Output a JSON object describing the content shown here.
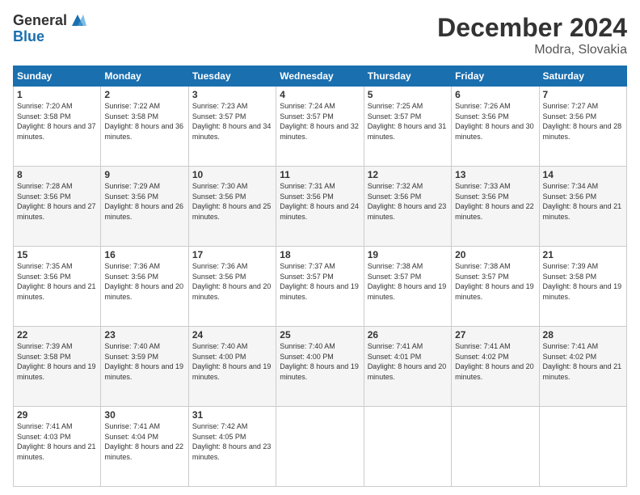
{
  "logo": {
    "general": "General",
    "blue": "Blue"
  },
  "header": {
    "month": "December 2024",
    "location": "Modra, Slovakia"
  },
  "days_of_week": [
    "Sunday",
    "Monday",
    "Tuesday",
    "Wednesday",
    "Thursday",
    "Friday",
    "Saturday"
  ],
  "weeks": [
    [
      {
        "day": "1",
        "sunrise": "7:20 AM",
        "sunset": "3:58 PM",
        "daylight": "8 hours and 37 minutes."
      },
      {
        "day": "2",
        "sunrise": "7:22 AM",
        "sunset": "3:58 PM",
        "daylight": "8 hours and 36 minutes."
      },
      {
        "day": "3",
        "sunrise": "7:23 AM",
        "sunset": "3:57 PM",
        "daylight": "8 hours and 34 minutes."
      },
      {
        "day": "4",
        "sunrise": "7:24 AM",
        "sunset": "3:57 PM",
        "daylight": "8 hours and 32 minutes."
      },
      {
        "day": "5",
        "sunrise": "7:25 AM",
        "sunset": "3:57 PM",
        "daylight": "8 hours and 31 minutes."
      },
      {
        "day": "6",
        "sunrise": "7:26 AM",
        "sunset": "3:56 PM",
        "daylight": "8 hours and 30 minutes."
      },
      {
        "day": "7",
        "sunrise": "7:27 AM",
        "sunset": "3:56 PM",
        "daylight": "8 hours and 28 minutes."
      }
    ],
    [
      {
        "day": "8",
        "sunrise": "7:28 AM",
        "sunset": "3:56 PM",
        "daylight": "8 hours and 27 minutes."
      },
      {
        "day": "9",
        "sunrise": "7:29 AM",
        "sunset": "3:56 PM",
        "daylight": "8 hours and 26 minutes."
      },
      {
        "day": "10",
        "sunrise": "7:30 AM",
        "sunset": "3:56 PM",
        "daylight": "8 hours and 25 minutes."
      },
      {
        "day": "11",
        "sunrise": "7:31 AM",
        "sunset": "3:56 PM",
        "daylight": "8 hours and 24 minutes."
      },
      {
        "day": "12",
        "sunrise": "7:32 AM",
        "sunset": "3:56 PM",
        "daylight": "8 hours and 23 minutes."
      },
      {
        "day": "13",
        "sunrise": "7:33 AM",
        "sunset": "3:56 PM",
        "daylight": "8 hours and 22 minutes."
      },
      {
        "day": "14",
        "sunrise": "7:34 AM",
        "sunset": "3:56 PM",
        "daylight": "8 hours and 21 minutes."
      }
    ],
    [
      {
        "day": "15",
        "sunrise": "7:35 AM",
        "sunset": "3:56 PM",
        "daylight": "8 hours and 21 minutes."
      },
      {
        "day": "16",
        "sunrise": "7:36 AM",
        "sunset": "3:56 PM",
        "daylight": "8 hours and 20 minutes."
      },
      {
        "day": "17",
        "sunrise": "7:36 AM",
        "sunset": "3:56 PM",
        "daylight": "8 hours and 20 minutes."
      },
      {
        "day": "18",
        "sunrise": "7:37 AM",
        "sunset": "3:57 PM",
        "daylight": "8 hours and 19 minutes."
      },
      {
        "day": "19",
        "sunrise": "7:38 AM",
        "sunset": "3:57 PM",
        "daylight": "8 hours and 19 minutes."
      },
      {
        "day": "20",
        "sunrise": "7:38 AM",
        "sunset": "3:57 PM",
        "daylight": "8 hours and 19 minutes."
      },
      {
        "day": "21",
        "sunrise": "7:39 AM",
        "sunset": "3:58 PM",
        "daylight": "8 hours and 19 minutes."
      }
    ],
    [
      {
        "day": "22",
        "sunrise": "7:39 AM",
        "sunset": "3:58 PM",
        "daylight": "8 hours and 19 minutes."
      },
      {
        "day": "23",
        "sunrise": "7:40 AM",
        "sunset": "3:59 PM",
        "daylight": "8 hours and 19 minutes."
      },
      {
        "day": "24",
        "sunrise": "7:40 AM",
        "sunset": "4:00 PM",
        "daylight": "8 hours and 19 minutes."
      },
      {
        "day": "25",
        "sunrise": "7:40 AM",
        "sunset": "4:00 PM",
        "daylight": "8 hours and 19 minutes."
      },
      {
        "day": "26",
        "sunrise": "7:41 AM",
        "sunset": "4:01 PM",
        "daylight": "8 hours and 20 minutes."
      },
      {
        "day": "27",
        "sunrise": "7:41 AM",
        "sunset": "4:02 PM",
        "daylight": "8 hours and 20 minutes."
      },
      {
        "day": "28",
        "sunrise": "7:41 AM",
        "sunset": "4:02 PM",
        "daylight": "8 hours and 21 minutes."
      }
    ],
    [
      {
        "day": "29",
        "sunrise": "7:41 AM",
        "sunset": "4:03 PM",
        "daylight": "8 hours and 21 minutes."
      },
      {
        "day": "30",
        "sunrise": "7:41 AM",
        "sunset": "4:04 PM",
        "daylight": "8 hours and 22 minutes."
      },
      {
        "day": "31",
        "sunrise": "7:42 AM",
        "sunset": "4:05 PM",
        "daylight": "8 hours and 23 minutes."
      },
      null,
      null,
      null,
      null
    ]
  ],
  "labels": {
    "sunrise": "Sunrise:",
    "sunset": "Sunset:",
    "daylight": "Daylight:"
  }
}
